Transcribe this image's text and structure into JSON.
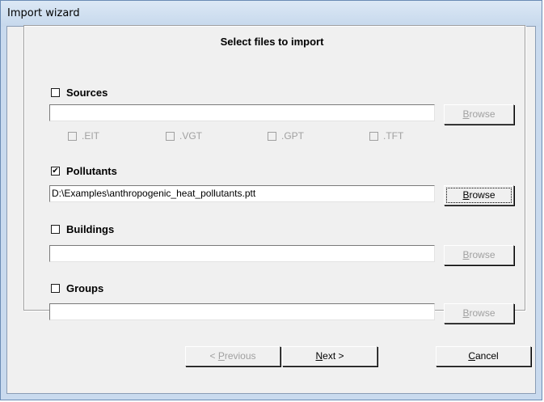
{
  "window": {
    "title": "Import wizard"
  },
  "heading": "Select files to import",
  "sources": {
    "label": "Sources",
    "checked": false,
    "path": "",
    "browse": {
      "pre": "",
      "key": "B",
      "post": "rowse"
    },
    "extensions": [
      ".EIT",
      ".VGT",
      ".GPT",
      ".TFT"
    ]
  },
  "pollutants": {
    "label": "Pollutants",
    "checked": true,
    "path": "D:\\Examples\\anthropogenic_heat_pollutants.ptt",
    "browse": {
      "pre": "",
      "key": "B",
      "post": "rowse"
    }
  },
  "buildings": {
    "label": "Buildings",
    "checked": false,
    "path": "",
    "browse": {
      "pre": "",
      "key": "B",
      "post": "rowse"
    }
  },
  "groups": {
    "label": "Groups",
    "checked": false,
    "path": "",
    "browse": {
      "pre": "",
      "key": "B",
      "post": "rowse"
    }
  },
  "footer": {
    "previous": {
      "pre": "< ",
      "key": "P",
      "post": "revious"
    },
    "next": {
      "pre": "",
      "key": "N",
      "post": "ext >"
    },
    "cancel": {
      "pre": "",
      "key": "C",
      "post": "ancel"
    }
  },
  "check_mark": "✔"
}
